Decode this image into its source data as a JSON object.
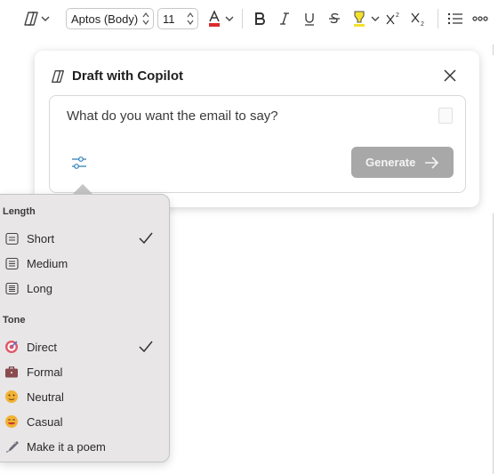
{
  "toolbar": {
    "font_name": "Aptos (Body)",
    "font_size": "11",
    "icons": [
      "copilot-icon",
      "chevron-down-icon",
      "font-color-icon",
      "bold-icon",
      "italic-icon",
      "underline-icon",
      "strikethrough-icon",
      "highlight-icon",
      "superscript-icon",
      "subscript-icon",
      "bullet-list-icon",
      "more-icon"
    ],
    "font_color": "#d92c2c",
    "highlight_color": "#f5e12a"
  },
  "copilot_card": {
    "title": "Draft with Copilot",
    "prompt_placeholder": "What do you want the email to say?",
    "generate_label": "Generate"
  },
  "options_menu": {
    "length": {
      "label": "Length",
      "items": [
        {
          "label": "Short",
          "icon": "document-icon",
          "checked": true
        },
        {
          "label": "Medium",
          "icon": "document-icon",
          "checked": false
        },
        {
          "label": "Long",
          "icon": "document-icon",
          "checked": false
        }
      ]
    },
    "tone": {
      "label": "Tone",
      "items": [
        {
          "label": "Direct",
          "icon": "target-icon",
          "checked": true
        },
        {
          "label": "Formal",
          "icon": "briefcase-icon",
          "checked": false
        },
        {
          "label": "Neutral",
          "icon": "neutral-face-icon",
          "checked": false
        },
        {
          "label": "Casual",
          "icon": "grin-face-icon",
          "checked": false
        },
        {
          "label": "Make it a poem",
          "icon": "fountain-pen-icon",
          "checked": false
        }
      ]
    }
  }
}
